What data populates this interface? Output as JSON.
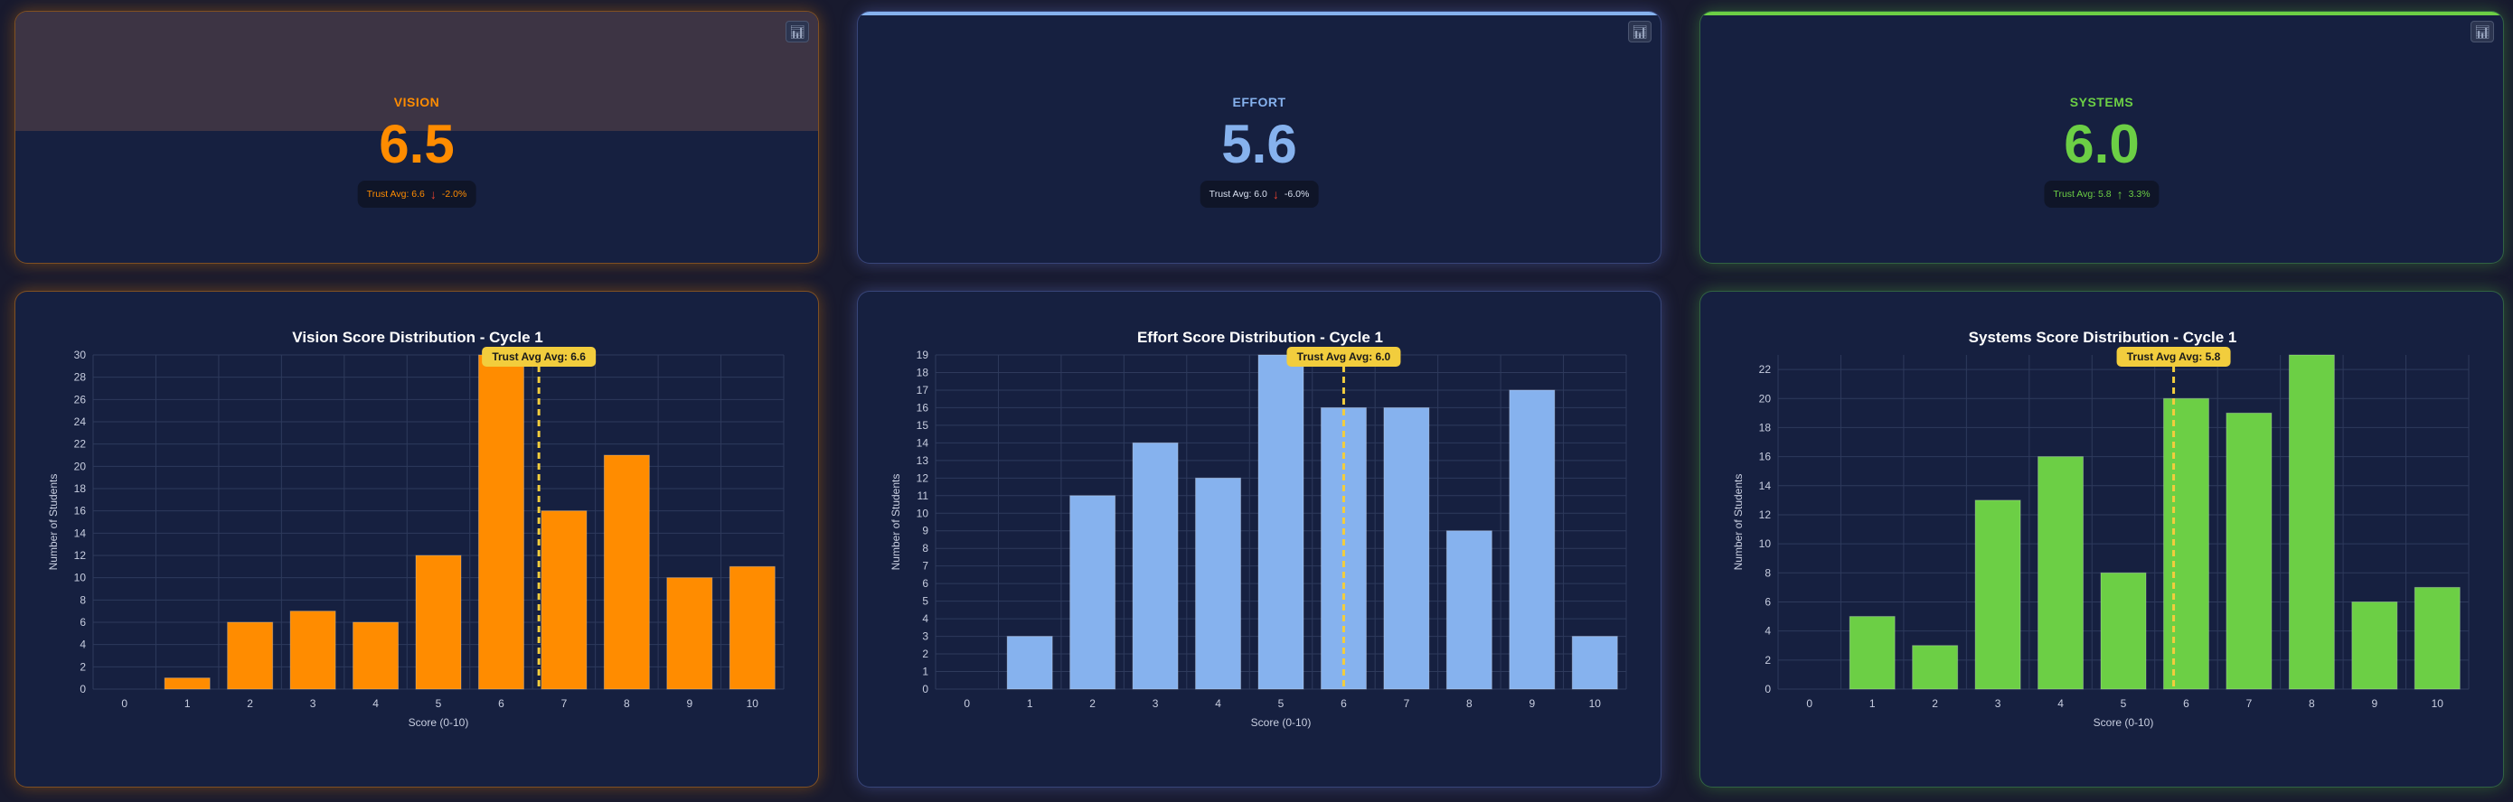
{
  "cards": [
    {
      "label": "VISION",
      "value": "6.5",
      "trust_text": "Trust Avg: 6.6",
      "trend": "down",
      "delta": "-2.0%",
      "color": "#ff8c00",
      "icon": "bar-chart-icon"
    },
    {
      "label": "EFFORT",
      "value": "5.6",
      "trust_text": "Trust Avg: 6.0",
      "trend": "down",
      "delta": "-6.0%",
      "color": "#86b2ee",
      "icon": "bar-chart-icon"
    },
    {
      "label": "SYSTEMS",
      "value": "6.0",
      "trust_text": "Trust Avg: 5.8",
      "trend": "up",
      "delta": "3.3%",
      "color": "#6ccf45",
      "icon": "bar-chart-icon"
    }
  ],
  "chart_data": [
    {
      "type": "bar",
      "title": "Vision Score Distribution - Cycle 1",
      "xlabel": "Score (0-10)",
      "ylabel": "Number of Students",
      "categories": [
        "0",
        "1",
        "2",
        "3",
        "4",
        "5",
        "6",
        "7",
        "8",
        "9",
        "10"
      ],
      "values": [
        0,
        1,
        6,
        7,
        6,
        12,
        30,
        16,
        21,
        10,
        11
      ],
      "ylim": [
        0,
        30
      ],
      "ytick_step": 2,
      "avg_line": {
        "value": 6.6,
        "label": "Trust Avg Avg: 6.6"
      },
      "color": "#ff8c00",
      "grid": true
    },
    {
      "type": "bar",
      "title": "Effort Score Distribution - Cycle 1",
      "xlabel": "Score (0-10)",
      "ylabel": "Number of Students",
      "categories": [
        "0",
        "1",
        "2",
        "3",
        "4",
        "5",
        "6",
        "7",
        "8",
        "9",
        "10"
      ],
      "values": [
        0,
        3,
        11,
        14,
        12,
        19,
        16,
        16,
        9,
        17,
        3
      ],
      "ylim": [
        0,
        19
      ],
      "ytick_step": 1,
      "avg_line": {
        "value": 6.0,
        "label": "Trust Avg Avg: 6.0"
      },
      "color": "#86b2ee",
      "grid": true
    },
    {
      "type": "bar",
      "title": "Systems Score Distribution - Cycle 1",
      "xlabel": "Score (0-10)",
      "ylabel": "Number of Students",
      "categories": [
        "0",
        "1",
        "2",
        "3",
        "4",
        "5",
        "6",
        "7",
        "8",
        "9",
        "10"
      ],
      "values": [
        0,
        5,
        3,
        13,
        16,
        8,
        20,
        19,
        23,
        6,
        7
      ],
      "ylim": [
        0,
        23
      ],
      "ytick_step": 2,
      "avg_line": {
        "value": 5.8,
        "label": "Trust Avg Avg: 5.8"
      },
      "color": "#6ccf45",
      "grid": true
    }
  ]
}
